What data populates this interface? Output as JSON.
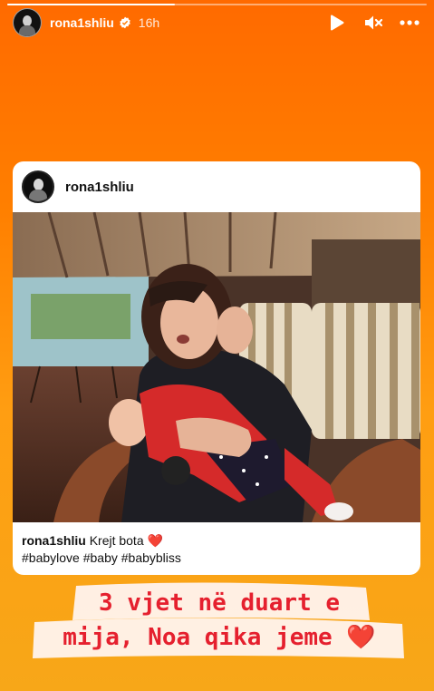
{
  "story": {
    "username": "rona1shliu",
    "time": "16h",
    "verified_icon": "verified-badge-icon",
    "controls": [
      "play-icon",
      "mute-icon",
      "more-icon"
    ]
  },
  "post": {
    "username": "rona1shliu",
    "caption_user": "rona1shliu",
    "caption_text": "Krejt bota",
    "caption_heart": "❤️",
    "hashtags": "#babylove #baby #babybliss",
    "photo_icon": "woman-with-baby-photo"
  },
  "sticker": {
    "line1": "3 vjet në duart e",
    "line2": "mija, Noa qika jeme ❤️"
  },
  "colors": {
    "background_top": "#ff6a00",
    "background_bottom": "#f7a718",
    "sticker_text": "#e5202e"
  }
}
